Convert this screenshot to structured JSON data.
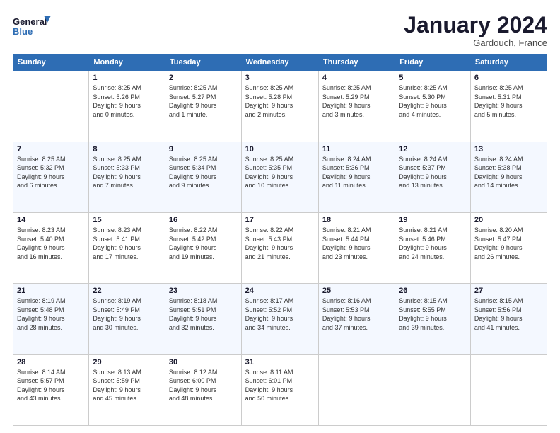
{
  "header": {
    "logo_line1": "General",
    "logo_line2": "Blue",
    "month_title": "January 2024",
    "location": "Gardouch, France"
  },
  "days_of_week": [
    "Sunday",
    "Monday",
    "Tuesday",
    "Wednesday",
    "Thursday",
    "Friday",
    "Saturday"
  ],
  "weeks": [
    [
      {
        "day": "",
        "info": ""
      },
      {
        "day": "1",
        "info": "Sunrise: 8:25 AM\nSunset: 5:26 PM\nDaylight: 9 hours\nand 0 minutes."
      },
      {
        "day": "2",
        "info": "Sunrise: 8:25 AM\nSunset: 5:27 PM\nDaylight: 9 hours\nand 1 minute."
      },
      {
        "day": "3",
        "info": "Sunrise: 8:25 AM\nSunset: 5:28 PM\nDaylight: 9 hours\nand 2 minutes."
      },
      {
        "day": "4",
        "info": "Sunrise: 8:25 AM\nSunset: 5:29 PM\nDaylight: 9 hours\nand 3 minutes."
      },
      {
        "day": "5",
        "info": "Sunrise: 8:25 AM\nSunset: 5:30 PM\nDaylight: 9 hours\nand 4 minutes."
      },
      {
        "day": "6",
        "info": "Sunrise: 8:25 AM\nSunset: 5:31 PM\nDaylight: 9 hours\nand 5 minutes."
      }
    ],
    [
      {
        "day": "7",
        "info": "Sunrise: 8:25 AM\nSunset: 5:32 PM\nDaylight: 9 hours\nand 6 minutes."
      },
      {
        "day": "8",
        "info": "Sunrise: 8:25 AM\nSunset: 5:33 PM\nDaylight: 9 hours\nand 7 minutes."
      },
      {
        "day": "9",
        "info": "Sunrise: 8:25 AM\nSunset: 5:34 PM\nDaylight: 9 hours\nand 9 minutes."
      },
      {
        "day": "10",
        "info": "Sunrise: 8:25 AM\nSunset: 5:35 PM\nDaylight: 9 hours\nand 10 minutes."
      },
      {
        "day": "11",
        "info": "Sunrise: 8:24 AM\nSunset: 5:36 PM\nDaylight: 9 hours\nand 11 minutes."
      },
      {
        "day": "12",
        "info": "Sunrise: 8:24 AM\nSunset: 5:37 PM\nDaylight: 9 hours\nand 13 minutes."
      },
      {
        "day": "13",
        "info": "Sunrise: 8:24 AM\nSunset: 5:38 PM\nDaylight: 9 hours\nand 14 minutes."
      }
    ],
    [
      {
        "day": "14",
        "info": "Sunrise: 8:23 AM\nSunset: 5:40 PM\nDaylight: 9 hours\nand 16 minutes."
      },
      {
        "day": "15",
        "info": "Sunrise: 8:23 AM\nSunset: 5:41 PM\nDaylight: 9 hours\nand 17 minutes."
      },
      {
        "day": "16",
        "info": "Sunrise: 8:22 AM\nSunset: 5:42 PM\nDaylight: 9 hours\nand 19 minutes."
      },
      {
        "day": "17",
        "info": "Sunrise: 8:22 AM\nSunset: 5:43 PM\nDaylight: 9 hours\nand 21 minutes."
      },
      {
        "day": "18",
        "info": "Sunrise: 8:21 AM\nSunset: 5:44 PM\nDaylight: 9 hours\nand 23 minutes."
      },
      {
        "day": "19",
        "info": "Sunrise: 8:21 AM\nSunset: 5:46 PM\nDaylight: 9 hours\nand 24 minutes."
      },
      {
        "day": "20",
        "info": "Sunrise: 8:20 AM\nSunset: 5:47 PM\nDaylight: 9 hours\nand 26 minutes."
      }
    ],
    [
      {
        "day": "21",
        "info": "Sunrise: 8:19 AM\nSunset: 5:48 PM\nDaylight: 9 hours\nand 28 minutes."
      },
      {
        "day": "22",
        "info": "Sunrise: 8:19 AM\nSunset: 5:49 PM\nDaylight: 9 hours\nand 30 minutes."
      },
      {
        "day": "23",
        "info": "Sunrise: 8:18 AM\nSunset: 5:51 PM\nDaylight: 9 hours\nand 32 minutes."
      },
      {
        "day": "24",
        "info": "Sunrise: 8:17 AM\nSunset: 5:52 PM\nDaylight: 9 hours\nand 34 minutes."
      },
      {
        "day": "25",
        "info": "Sunrise: 8:16 AM\nSunset: 5:53 PM\nDaylight: 9 hours\nand 37 minutes."
      },
      {
        "day": "26",
        "info": "Sunrise: 8:15 AM\nSunset: 5:55 PM\nDaylight: 9 hours\nand 39 minutes."
      },
      {
        "day": "27",
        "info": "Sunrise: 8:15 AM\nSunset: 5:56 PM\nDaylight: 9 hours\nand 41 minutes."
      }
    ],
    [
      {
        "day": "28",
        "info": "Sunrise: 8:14 AM\nSunset: 5:57 PM\nDaylight: 9 hours\nand 43 minutes."
      },
      {
        "day": "29",
        "info": "Sunrise: 8:13 AM\nSunset: 5:59 PM\nDaylight: 9 hours\nand 45 minutes."
      },
      {
        "day": "30",
        "info": "Sunrise: 8:12 AM\nSunset: 6:00 PM\nDaylight: 9 hours\nand 48 minutes."
      },
      {
        "day": "31",
        "info": "Sunrise: 8:11 AM\nSunset: 6:01 PM\nDaylight: 9 hours\nand 50 minutes."
      },
      {
        "day": "",
        "info": ""
      },
      {
        "day": "",
        "info": ""
      },
      {
        "day": "",
        "info": ""
      }
    ]
  ]
}
